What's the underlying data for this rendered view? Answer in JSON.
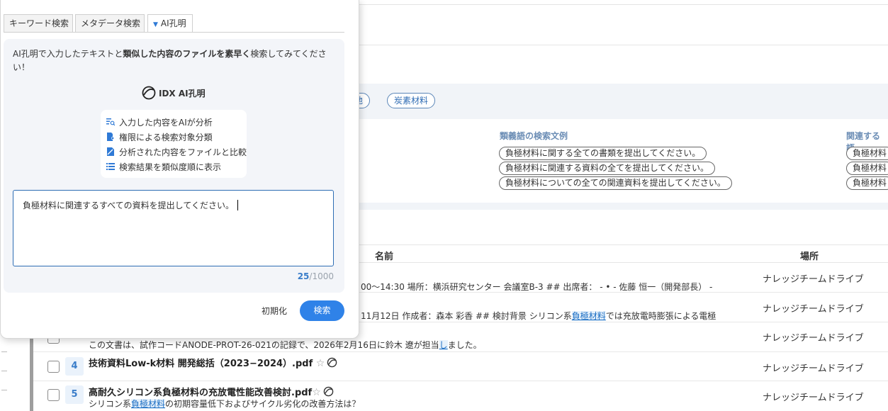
{
  "popup": {
    "tabs": [
      {
        "label": "キーワード検索"
      },
      {
        "label": "メタデータ検索"
      },
      {
        "label": "AI孔明",
        "caret": "▼"
      }
    ],
    "intro_pre": "AI孔明で入力したテキストと",
    "intro_bold": "類似した内容のファイルを素早く",
    "intro_post": "検索してみてください！",
    "logo_text": "IDX AI孔明",
    "features": [
      {
        "label": "入力した内容をAIが分析",
        "icon": "text-search-icon"
      },
      {
        "label": "権限による検索対象分類",
        "icon": "document-person-icon"
      },
      {
        "label": "分析された内容をファイルと比較",
        "icon": "file-compare-icon"
      },
      {
        "label": "検索結果を類似度順に表示",
        "icon": "list-icon"
      }
    ],
    "query": "負極材料に関連するすべての資料を提出してください。",
    "counter_current": "25",
    "counter_max": "/1000",
    "reset_label": "初期化",
    "search_label": "検索"
  },
  "background": {
    "keyword_chips": [
      "電池",
      "炭素材料"
    ],
    "synonym_title": "類義語の検索文例",
    "synonym_examples": [
      "負極材料に関する全ての書類を提出してください。",
      "負極材料に関連する資料の全てを提出してください。",
      "負極材料についての全ての関連資料を提出してください。"
    ],
    "related_title": "関連する語",
    "related_examples": [
      "負極材料",
      "負極材料",
      "負極材料"
    ],
    "table": {
      "col_name": "名前",
      "col_location": "場所",
      "rows": [
        {
          "snippet": "00〜14:30 場所：横浜研究センター 会議室B-3 ## 出席者： - • - 佐藤 恒一（開発部長） -",
          "location": "ナレッジチームドライブ"
        },
        {
          "snippet_pre": "11月12日 作成者：森本 彩香 ## 検討背景 シリコン系",
          "snippet_hl": "負極材料",
          "snippet_post": "では充放電時膨張による電極",
          "location": "ナレッジチームドライブ"
        },
        {
          "snippet_pre": "この文書は、試作コードANODE-PROT-26-021の記録で、2026年2月16日に鈴木 遼が担当",
          "snippet_hl": "し",
          "snippet_post": "ました。",
          "location": "ナレッジチームドライブ"
        },
        {
          "num": "4",
          "title": "技術資料Low-k材料 開発総括（2023−2024）.pdf",
          "location": "ナレッジチームドライブ"
        },
        {
          "num": "5",
          "title": "高耐久シリコン系負極材料の充放電性能改善検討.pdf",
          "snippet_pre": "シリコン系",
          "snippet_hl": "負極材料",
          "snippet_post": "の初期容量低下およびサイクル劣化の改善方法は？",
          "location": "ナレッジチームドライブ"
        }
      ]
    }
  }
}
